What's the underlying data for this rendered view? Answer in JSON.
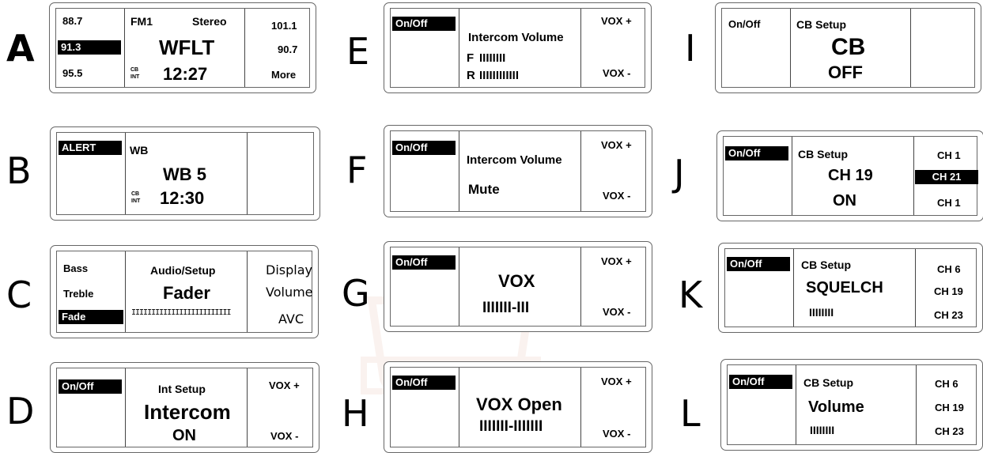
{
  "panels": {
    "A": {
      "letter": "A",
      "left_1": "88.7",
      "left_2": "91.3",
      "left_3": "95.5",
      "band": "FM1",
      "mode": "Stereo",
      "station": "WFLT",
      "cb": "CB",
      "int": "INT",
      "time": "12:27",
      "right_1": "101.1",
      "right_2": "90.7",
      "right_3": "More"
    },
    "B": {
      "letter": "B",
      "alert": "ALERT",
      "band": "WB",
      "station": "WB 5",
      "cb": "CB",
      "int": "INT",
      "time": "12:30"
    },
    "C": {
      "letter": "C",
      "left_1": "Bass",
      "left_2": "Treble",
      "left_3": "Fade",
      "title": "Audio/Setup",
      "value": "Fader",
      "bar": "IIIIIIIIIIIIIIIIIIIIIIIII",
      "right_1": "Display",
      "right_2": "Volume",
      "right_3": "AVC"
    },
    "D": {
      "letter": "D",
      "onoff": "On/Off",
      "title": "Int Setup",
      "value": "Intercom",
      "state": "ON",
      "vox_plus": "VOX +",
      "vox_minus": "VOX -"
    },
    "E": {
      "letter": "E",
      "onoff": "On/Off",
      "title": "Intercom Volume",
      "front_label": "F",
      "front_bars": "IIIIIIII",
      "rear_label": "R",
      "rear_bars": "IIIIIIIIIIII",
      "vox_plus": "VOX +",
      "vox_minus": "VOX -"
    },
    "F": {
      "letter": "F",
      "onoff": "On/Off",
      "title": "Intercom Volume",
      "value": "Mute",
      "vox_plus": "VOX +",
      "vox_minus": "VOX -"
    },
    "G": {
      "letter": "G",
      "onoff": "On/Off",
      "title": "VOX",
      "bars": "IIIIIII-III",
      "vox_plus": "VOX +",
      "vox_minus": "VOX -"
    },
    "H": {
      "letter": "H",
      "onoff": "On/Off",
      "title": "VOX Open",
      "bars": "IIIIIII-IIIIIII",
      "vox_plus": "VOX +",
      "vox_minus": "VOX -"
    },
    "I": {
      "letter": "I",
      "onoff": "On/Off",
      "title": "CB Setup",
      "value": "CB",
      "state": "OFF"
    },
    "J": {
      "letter": "J",
      "onoff": "On/Off",
      "title": "CB Setup",
      "value": "CH 19",
      "state": "ON",
      "ch_1": "CH 1",
      "ch_2": "CH 21",
      "ch_3": "CH 1"
    },
    "K": {
      "letter": "K",
      "onoff": "On/Off",
      "title": "CB Setup",
      "value": "SQUELCH",
      "bars": "IIIIIIII",
      "ch_1": "CH 6",
      "ch_2": "CH 19",
      "ch_3": "CH 23"
    },
    "L": {
      "letter": "L",
      "onoff": "On/Off",
      "title": "CB Setup",
      "value": "Volume",
      "bars": "IIIIIIII",
      "ch_1": "CH 6",
      "ch_2": "CH 19",
      "ch_3": "CH 23"
    }
  },
  "watermark": {
    "text": "MOTOR HARLEY-DAVIDSON CYCLES",
    "color": "#c0562a"
  }
}
